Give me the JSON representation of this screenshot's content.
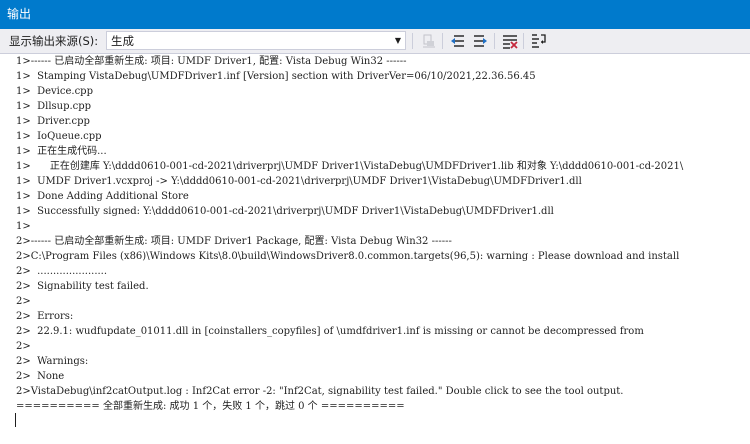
{
  "window": {
    "title": "输出"
  },
  "toolbar": {
    "source_label": "显示输出来源(S):",
    "source_value": "生成"
  },
  "log": {
    "lines": [
      "1>------ 已启动全部重新生成: 项目: UMDF Driver1, 配置: Vista Debug Win32 ------",
      "1>  Stamping VistaDebug\\UMDFDriver1.inf [Version] section with DriverVer=06/10/2021,22.36.56.45",
      "1>  Device.cpp",
      "1>  Dllsup.cpp",
      "1>  Driver.cpp",
      "1>  IoQueue.cpp",
      "1>  正在生成代码...",
      "1>      正在创建库 Y:\\dddd0610-001-cd-2021\\driverprj\\UMDF Driver1\\VistaDebug\\UMDFDriver1.lib 和对象 Y:\\dddd0610-001-cd-2021\\",
      "1>  UMDF Driver1.vcxproj -> Y:\\dddd0610-001-cd-2021\\driverprj\\UMDF Driver1\\VistaDebug\\UMDFDriver1.dll",
      "1>  Done Adding Additional Store",
      "1>  Successfully signed: Y:\\dddd0610-001-cd-2021\\driverprj\\UMDF Driver1\\VistaDebug\\UMDFDriver1.dll",
      "1>",
      "2>------ 已启动全部重新生成: 项目: UMDF Driver1 Package, 配置: Vista Debug Win32 ------",
      "2>C:\\Program Files (x86)\\Windows Kits\\8.0\\build\\WindowsDriver8.0.common.targets(96,5): warning : Please download and install",
      "2>  ......................",
      "2>  Signability test failed.",
      "2>",
      "2>  Errors:",
      "2>  22.9.1: wudfupdate_01011.dll in [coinstallers_copyfiles] of \\umdfdriver1.inf is missing or cannot be decompressed from",
      "2>",
      "2>  Warnings:",
      "2>  None",
      "2>VistaDebug\\inf2catOutput.log : Inf2Cat error -2: \"Inf2Cat, signability test failed.\" Double click to see the tool output.",
      "========== 全部重新生成: 成功 1 个，失败 1 个，跳过 0 个 =========="
    ]
  },
  "colors": {
    "titlebar": "#007acc",
    "toolbar": "#eeeef2",
    "border": "#cccedb",
    "text": "#1e1e1e"
  },
  "icons": [
    "clear-output-icon",
    "previous-message-icon",
    "next-message-icon",
    "clear-all-icon",
    "word-wrap-icon"
  ]
}
